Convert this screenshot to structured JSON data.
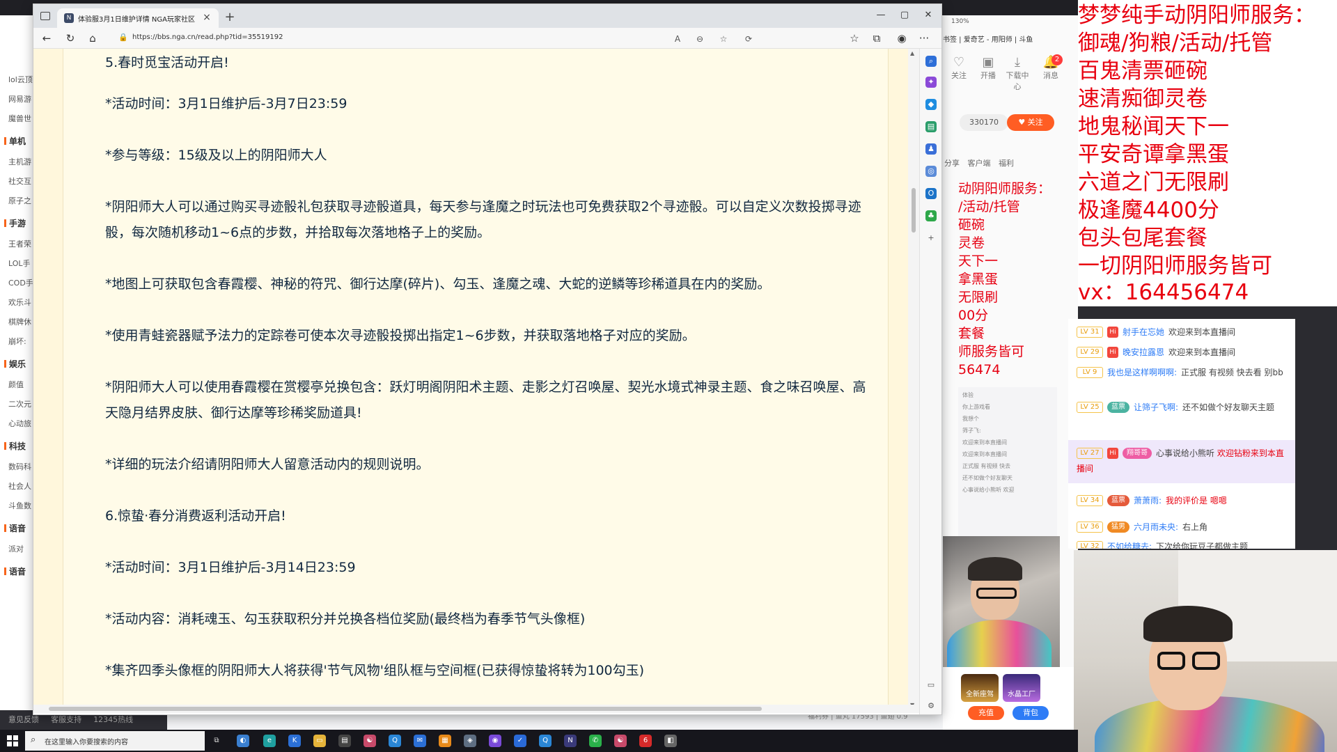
{
  "browser": {
    "tab_title": "体验服3月1日维护详情 NGA玩家社区",
    "url": "https://bbs.nga.cn/read.php?tid=35519192",
    "new_tab": "+",
    "tab_close": "×",
    "win_min": "—",
    "win_max": "▢",
    "win_close": "✕",
    "more": "···"
  },
  "post": {
    "lines": [
      "5.春时觅宝活动开启!",
      "*活动时间：3月1日维护后-3月7日23:59",
      "*参与等级：15级及以上的阴阳师大人",
      "*阴阳师大人可以通过购买寻迹骰礼包获取寻迹骰道具，每天参与逢魔之时玩法也可免费获取2个寻迹骰。可以自定义次数投掷寻迹",
      "骰，每次随机移动1~6点的步数，并拾取每次落地格子上的奖励。",
      "*地图上可获取包含春霞樱、神秘的符咒、御行达摩(碎片)、勾玉、逢魔之魂、大蛇的逆鳞等珍稀道具在内的奖励。",
      "*使用青蛙瓷器赋予法力的定踪卷可使本次寻迹骰投掷出指定1~6步数，并获取落地格子对应的奖励。",
      "*阴阳师大人可以使用春霞樱在赏樱亭兑换包含：跃灯明阁阴阳术主题、走影之灯召唤屋、契光水境式神录主题、食之味召唤屋、高",
      "天隐月结界皮肤、御行达摩等珍稀奖励道具!",
      "*详细的玩法介绍请阴阳师大人留意活动内的规则说明。",
      "6.惊蛰·春分消费返利活动开启!",
      "*活动时间：3月1日维护后-3月14日23:59",
      "*活动内容：消耗魂玉、勾玉获取积分并兑换各档位奖励(最终档为春季节气头像框)",
      "*集齐四季头像框的阴阳师大人将获得'节气风物'组队框与空间框(已获得惊蛰将转为100勾玉)"
    ]
  },
  "overlay": {
    "lines": [
      "梦梦纯手动阴阳师服务：",
      "御魂/狗粮/活动/托管",
      "百鬼清票砸碗",
      "速清痴御灵卷",
      "地鬼秘闻天下一",
      "平安奇谭拿黑蛋",
      "六道之门无限刷",
      "极逢魔4400分",
      "包头包尾套餐",
      "一切阴阳师服务皆可",
      "vx：164456474"
    ],
    "color": "#e8000f"
  },
  "overlay_dup": {
    "lines": [
      "动阴阳师服务：",
      "/活动/托管",
      "砸碗",
      "灵卷",
      "天下一",
      "拿黑蛋",
      "无限刷",
      "00分",
      "套餐",
      "师服务皆可",
      "56474"
    ]
  },
  "chat": [
    {
      "lv": "LV 31",
      "badge": "Hi",
      "user": "射手在忘她",
      "msg": "欢迎来到本直播间"
    },
    {
      "lv": "LV 29",
      "badge": "Hi",
      "user": "晚安拉露恩",
      "msg": "欢迎来到本直播间"
    },
    {
      "lv": "LV 9",
      "user": "我也是这样啊啊啊:",
      "msg": "正式服 有视频 快去看 别bb"
    },
    {
      "lv": "LV 25",
      "fan": "蓝票",
      "user": "让筛子飞啊:",
      "msg": "还不如做个好友聊天主题"
    },
    {
      "lv": "LV 27",
      "badge": "Hi",
      "fan": "翔哥哥",
      "user": "心事说给小熊听",
      "msg": "欢迎钻粉来到本直播间"
    },
    {
      "lv": "LV 34",
      "fan": "蓝票",
      "user": "萧萧雨:",
      "msg": "我的评价是 嗯嗯"
    },
    {
      "lv": "LV 36",
      "fan": "猛男",
      "user": "六月雨未央:",
      "msg": "右上角"
    },
    {
      "lv": "LV 32",
      "user": "不如给糖去:",
      "msg": "下次给你玩豆子都做主题"
    }
  ],
  "stream_page": {
    "address_bit": "130%",
    "bookmarks": "书签 | 爱奇艺 - 用阳师 | 斗鱼",
    "top_icons": [
      "关注",
      "开播",
      "下载中心",
      "消息"
    ],
    "bell_count": "2",
    "follow_count": "330170",
    "follow_label": "♥ 关注",
    "share_items": [
      "分享",
      "客户端",
      "福利"
    ],
    "left_nav": [
      "lol云顶",
      "网易游",
      "魔兽世",
      "单机",
      "主机游",
      "社交互",
      "原子之",
      "手游",
      "王者荣",
      "LOL手",
      "COD手",
      "欢乐斗",
      "棋牌休",
      "崩坏:",
      "娱乐",
      "颜值",
      "二次元",
      "心动旅",
      "科技",
      "数码科",
      "社会人",
      "斗鱼数",
      "语音",
      "派对",
      "语音"
    ],
    "left_footer": [
      "意见反馈",
      "客服支持",
      "12345热线"
    ],
    "mini_chat": [
      "体验",
      "你上游戏看",
      "我想个",
      "筛子飞:",
      "欢迎来到本直播间",
      "欢迎来到本直播间",
      "正式服 有视频 快去",
      "还不如做个好友聊天",
      "心事说给小熊听 欢迎"
    ],
    "gifts": [
      "全新座驾",
      "水晶工厂"
    ],
    "recharge": "充值",
    "bag": "背包",
    "bottom_stat": "福利券 | 鱼丸 17593 | 鱼翅 0.9"
  },
  "taskbar": {
    "search_placeholder": "在这里输入你要搜索的内容"
  }
}
